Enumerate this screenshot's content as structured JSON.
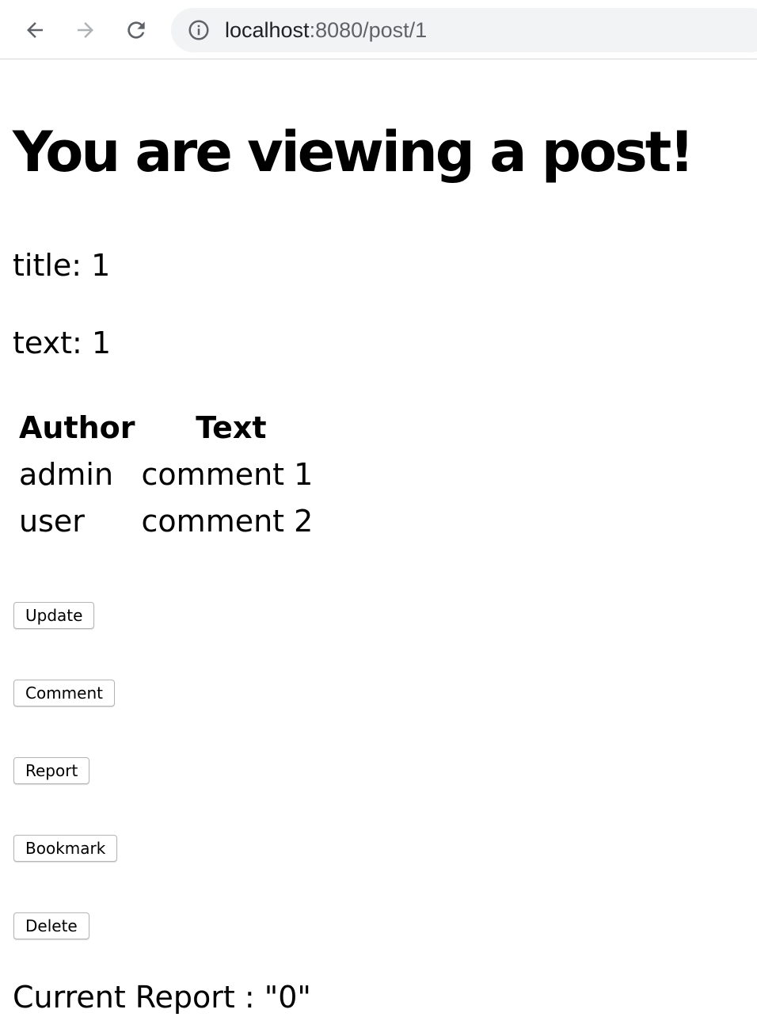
{
  "browser": {
    "url_host": "localhost",
    "url_rest": ":8080/post/1"
  },
  "page": {
    "heading": "You are viewing a post!",
    "title_line": "title: 1",
    "text_line": "text: 1"
  },
  "comments": {
    "headers": [
      "Author",
      "Text"
    ],
    "rows": [
      {
        "author": "admin",
        "text": "comment 1"
      },
      {
        "author": "user",
        "text": "comment 2"
      }
    ]
  },
  "actions": {
    "update": "Update",
    "comment": "Comment",
    "report": "Report",
    "bookmark": "Bookmark",
    "delete": "Delete"
  },
  "status": {
    "report_line": "Current Report : \"0\""
  },
  "icons": {
    "back": "arrow-left-icon",
    "forward": "arrow-right-icon",
    "reload": "reload-icon",
    "info": "info-icon"
  }
}
